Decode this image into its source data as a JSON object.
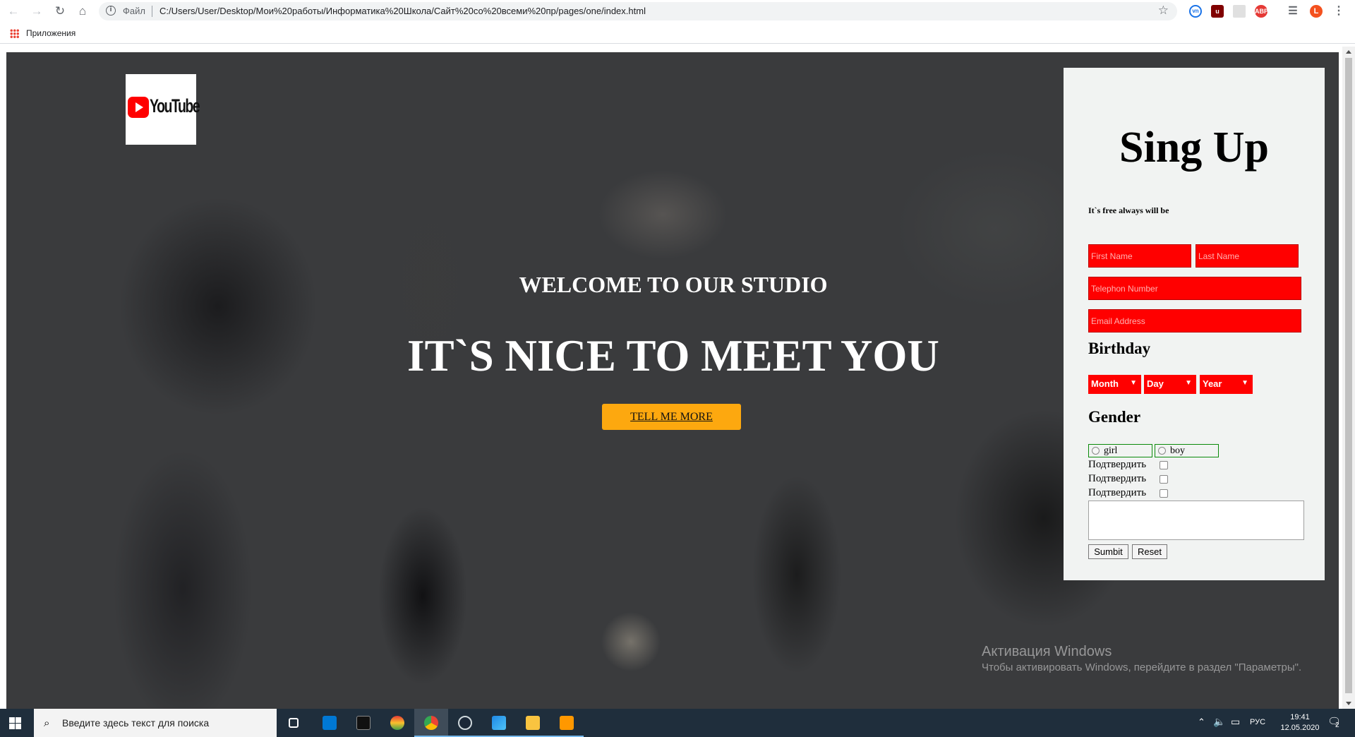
{
  "browser": {
    "file_label": "Файл",
    "url": "C:/Users/User/Desktop/Мои%20работы/Информатика%20Школа/Сайт%20со%20всеми%20пр/pages/one/index.html",
    "bookmark_apps": "Приложения",
    "profile_initial": "L"
  },
  "page": {
    "logo_text": "YouTube",
    "hero_subtitle": "WELCOME TO OUR STUDIO",
    "hero_title": "IT`S NICE TO MEET YOU",
    "cta_label": "TELL ME MORE",
    "accent_color": "#fda80f"
  },
  "signup": {
    "title": "Sing Up",
    "tagline": "It`s free always will be",
    "first_name_placeholder": "First Name",
    "last_name_placeholder": "Last Name",
    "phone_placeholder": "Telephon Number",
    "email_placeholder": "Email Address",
    "birthday_heading": "Birthday",
    "month_label": "Month",
    "day_label": "Day",
    "year_label": "Year",
    "gender_heading": "Gender",
    "gender_options": [
      "girl",
      "boy"
    ],
    "confirm_label": "Подтвердить",
    "submit_label": "Sumbit",
    "reset_label": "Reset",
    "field_color": "#ff0000"
  },
  "windows_watermark": {
    "title": "Активация Windows",
    "subtitle": "Чтобы активировать Windows, перейдите в раздел \"Параметры\"."
  },
  "taskbar": {
    "search_placeholder": "Введите здесь текст для поиска",
    "language": "РУС",
    "time": "19:41",
    "date": "12.05.2020",
    "notification_count": "2"
  }
}
